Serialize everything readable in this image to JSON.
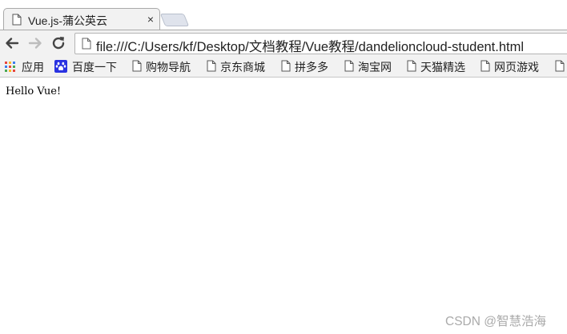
{
  "tab": {
    "title": "Vue.js-蒲公英云",
    "close_glyph": "×"
  },
  "address_bar": {
    "url": "file:///C:/Users/kf/Desktop/文档教程/Vue教程/dandelioncloud-student.html"
  },
  "bookmarks": [
    {
      "label": "应用",
      "icon": "apps-grid-icon"
    },
    {
      "label": "百度一下",
      "icon": "baidu-paw-icon"
    },
    {
      "label": "购物导航",
      "icon": "page-icon"
    },
    {
      "label": "京东商城",
      "icon": "page-icon"
    },
    {
      "label": "拼多多",
      "icon": "page-icon"
    },
    {
      "label": "淘宝网",
      "icon": "page-icon"
    },
    {
      "label": "天猫精选",
      "icon": "page-icon"
    },
    {
      "label": "网页游戏",
      "icon": "page-icon"
    }
  ],
  "content": {
    "text": "Hello Vue!"
  },
  "watermark": "CSDN @智慧浩海",
  "colors": {
    "chrome": "#f2f2f2",
    "baidu_blue": "#2932e1"
  }
}
